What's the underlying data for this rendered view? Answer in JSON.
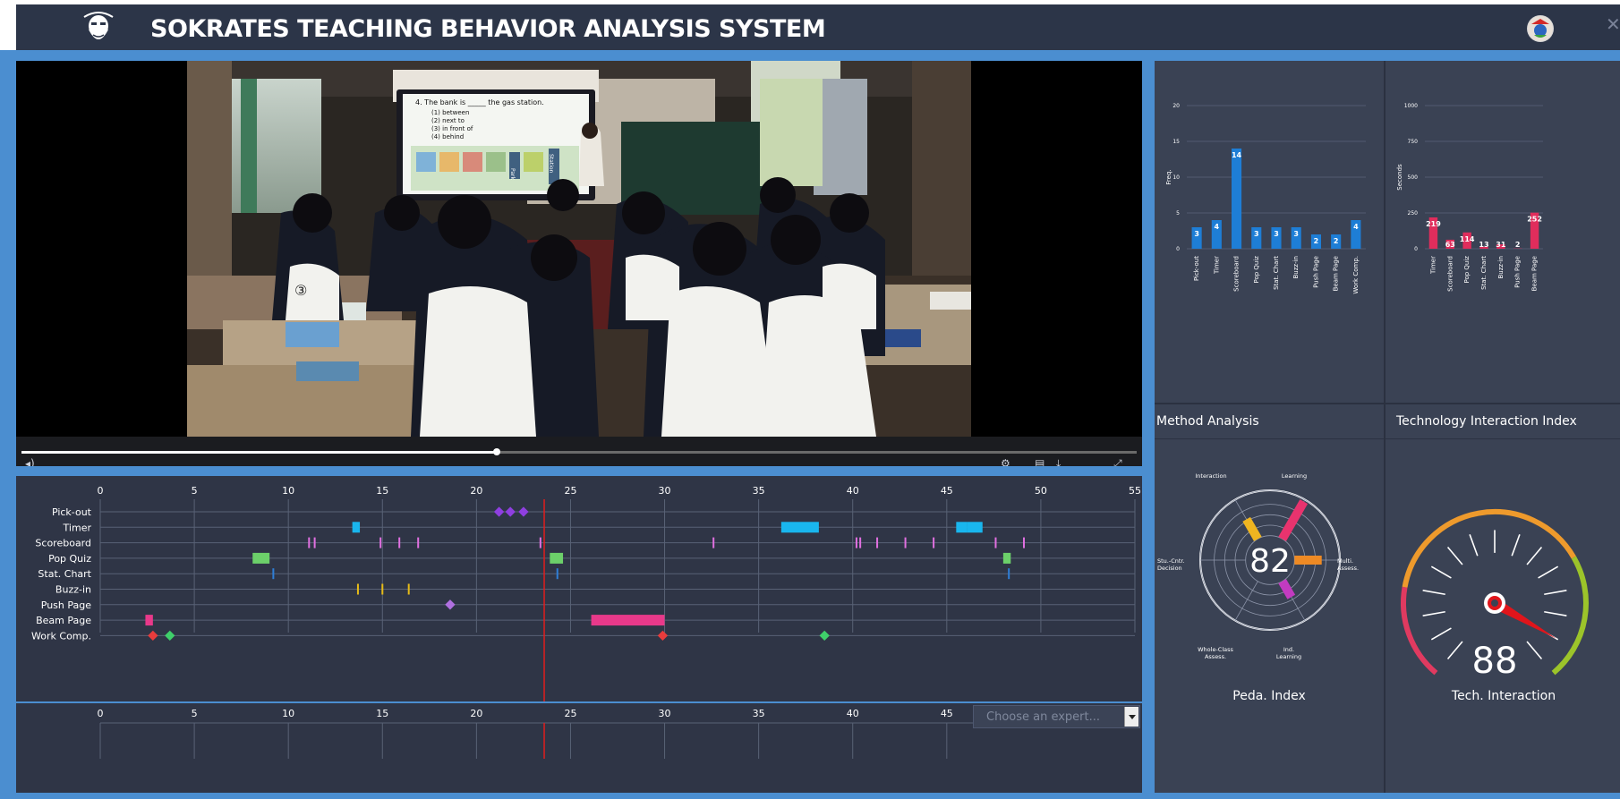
{
  "app": {
    "title": "SOKRATES TEACHING BEHAVIOR ANALYSIS SYSTEM",
    "logo_icon": "socrates-bust-logo",
    "avatar_icon": "school-badge",
    "close_icon": "close-icon"
  },
  "video": {
    "slide": {
      "question": "4. The bank is _____ the gas station.",
      "options": [
        "(1) between",
        "(2) next to",
        "(3) in front of",
        "(4) behind"
      ],
      "tags": [
        "Park",
        "Station"
      ]
    },
    "table_number": "③",
    "progress": 0.426
  },
  "timeline": {
    "x_ticks": [
      "0",
      "5",
      "10",
      "15",
      "20",
      "25",
      "30",
      "35",
      "40",
      "45",
      "50",
      "55"
    ],
    "x_ticks_lower": [
      "0",
      "5",
      "10",
      "15",
      "20",
      "25",
      "30",
      "35",
      "40",
      "45"
    ],
    "rows": [
      "Pick-out",
      "Timer",
      "Scoreboard",
      "Pop Quiz",
      "Stat. Chart",
      "Buzz-in",
      "Push Page",
      "Beam Page",
      "Work Comp."
    ],
    "playhead_min": 23.6,
    "expert_placeholder": "Choose an expert...",
    "events": {
      "Pick-out": {
        "type": "diamond",
        "color": "#8f3fe0",
        "t": [
          21.2,
          21.8,
          22.5
        ]
      },
      "Timer": {
        "type": "bar",
        "color": "#19b6ee",
        "spans": [
          [
            13.4,
            13.8
          ],
          [
            36.2,
            38.2
          ],
          [
            45.5,
            46.1
          ],
          [
            46.1,
            46.9
          ]
        ]
      },
      "Scoreboard": {
        "type": "tick",
        "color": "#e070e0",
        "t": [
          11.1,
          11.4,
          14.9,
          15.9,
          16.9,
          23.4,
          32.6,
          40.2,
          40.4,
          41.3,
          42.8,
          44.3,
          47.6,
          49.1
        ]
      },
      "Pop Quiz": {
        "type": "bar",
        "color": "#6cd06a",
        "spans": [
          [
            8.1,
            9.0
          ],
          [
            23.9,
            24.6
          ],
          [
            48.0,
            48.4
          ]
        ]
      },
      "Stat. Chart": {
        "type": "tick",
        "color": "#2f7ed6",
        "t": [
          9.2,
          24.3,
          48.3
        ]
      },
      "Buzz-in": {
        "type": "tick",
        "color": "#e6bb18",
        "t": [
          13.7,
          15.0,
          16.4
        ]
      },
      "Push Page": {
        "type": "diamond",
        "color": "#b070e0",
        "t": [
          18.6
        ]
      },
      "Beam Page": {
        "type": "bar",
        "color": "#e8398a",
        "spans": [
          [
            2.4,
            2.8
          ],
          [
            26.1,
            30.0
          ]
        ]
      },
      "Work Comp.": {
        "type": "diamond2",
        "t": [
          2.8,
          3.7,
          29.9,
          38.5
        ],
        "colors": [
          "#e83c3c",
          "#3fcf6a",
          "#e83c3c",
          "#3fcf6a"
        ]
      }
    }
  },
  "chart_data": [
    {
      "type": "bar",
      "categories": [
        "Pick-out",
        "Timer",
        "Scoreboard",
        "Pop Quiz",
        "Stat. Chart",
        "Buzz-in",
        "Push Page",
        "Beam Page",
        "Work Comp."
      ],
      "values": [
        3,
        4,
        14,
        3,
        3,
        3,
        2,
        2,
        4
      ],
      "ylabel": "Freq.",
      "ylim": [
        0,
        20
      ],
      "yticks": [
        "0",
        "5",
        "10",
        "15",
        "20"
      ],
      "color": "#1e7ed6",
      "grid": true
    },
    {
      "type": "bar",
      "categories": [
        "Timer",
        "Scoreboard",
        "Pop Quiz",
        "Stat. Chart",
        "Buzz-in",
        "Push Page",
        "Beam Page"
      ],
      "values": [
        219,
        63,
        114,
        13,
        31,
        2,
        252
      ],
      "ylabel": "Seconds",
      "ylim": [
        0,
        1000
      ],
      "yticks": [
        "0",
        "250",
        "500",
        "750",
        "1000"
      ],
      "color": "#e02d5c",
      "grid": true
    }
  ],
  "method": {
    "title": "Method Analysis",
    "score": "82",
    "label": "Peda. Index",
    "axes": [
      "Group Learning",
      "Multi. Assess.",
      "Ind. Learning",
      "Whole-Class Assess.",
      "Stu.-Cntr. Decision",
      "Whole-Class Interaction"
    ],
    "values": [
      0.95,
      0.6,
      0.4,
      0.0,
      0.0,
      0.5
    ],
    "colors": [
      "#e8336e",
      "#ee8a24",
      "#c23bc0",
      "#888888",
      "#888888",
      "#efb520"
    ]
  },
  "tech": {
    "title": "Technology Interaction Index",
    "score": "88",
    "label": "Tech.  Interaction"
  }
}
